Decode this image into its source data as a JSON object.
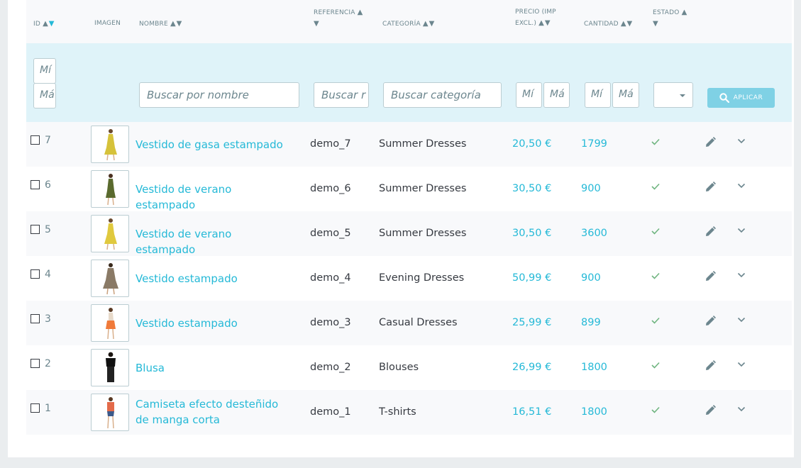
{
  "headers": {
    "id": "ID",
    "image": "Imagen",
    "name": "Nombre",
    "reference": "Referencia",
    "category": "Categoría",
    "price_line1": "Precio (imp",
    "price_line2": "excl.)",
    "quantity": "Cantidad",
    "status": "Estado",
    "sort_arrows": "▲▼",
    "sort_up": "▲",
    "sort_down": "▼"
  },
  "filters": {
    "id_min": "Mí",
    "id_max": "Má",
    "name_placeholder": "Buscar por nombre",
    "ref_placeholder": "Buscar r",
    "category_placeholder": "Buscar categoría",
    "price_min": "Mí",
    "price_max": "Má",
    "qty_min": "Mí",
    "qty_max": "Má",
    "status_value": "",
    "apply_label": "APLICAR"
  },
  "products": [
    {
      "id": "7",
      "name": "Vestido de gasa estampado",
      "reference": "demo_7",
      "category": "Summer Dresses",
      "price": "20,50 €",
      "quantity": "1799"
    },
    {
      "id": "6",
      "name": "Vestido de verano estampado",
      "reference": "demo_6",
      "category": "Summer Dresses",
      "price": "30,50 €",
      "quantity": "900"
    },
    {
      "id": "5",
      "name": "Vestido de verano estampado",
      "reference": "demo_5",
      "category": "Summer Dresses",
      "price": "30,50 €",
      "quantity": "3600"
    },
    {
      "id": "4",
      "name": "Vestido estampado",
      "reference": "demo_4",
      "category": "Evening Dresses",
      "price": "50,99 €",
      "quantity": "900"
    },
    {
      "id": "3",
      "name": "Vestido estampado",
      "reference": "demo_3",
      "category": "Casual Dresses",
      "price": "25,99 €",
      "quantity": "899"
    },
    {
      "id": "2",
      "name": "Blusa",
      "reference": "demo_2",
      "category": "Blouses",
      "price": "26,99 €",
      "quantity": "1800"
    },
    {
      "id": "1",
      "name": "Camiseta efecto desteñido de manga corta",
      "reference": "demo_1",
      "category": "T-shirts",
      "price": "16,51 €",
      "quantity": "1800"
    }
  ],
  "colors": {
    "accent": "#25b9d7",
    "filter_bg": "#dff3f9",
    "status_ok": "#70b580",
    "icon_gray": "#6c868e"
  },
  "icons": {
    "status": "check-icon",
    "edit": "pencil-icon",
    "more": "chevron-down-icon",
    "apply": "search-icon"
  }
}
